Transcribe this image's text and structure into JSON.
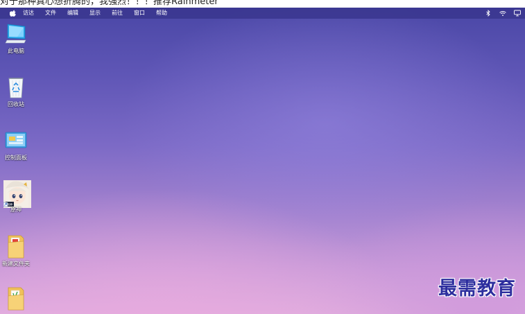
{
  "caption": "对于那种真心想折腾的，我强烈！！！推荐Rainmeter",
  "menubar": {
    "apple_icon": "apple-logo-icon",
    "items": [
      "访达",
      "文件",
      "编辑",
      "显示",
      "前往",
      "窗口",
      "帮助"
    ],
    "status_icons": [
      "bluetooth-icon",
      "wifi-icon",
      "display-icon"
    ]
  },
  "desktop": {
    "icons": [
      {
        "label": "此电脑",
        "icon": "computer-icon"
      },
      {
        "label": "回收站",
        "icon": "recycle-bin-icon"
      },
      {
        "label": "控制面板",
        "icon": "control-panel-icon"
      },
      {
        "label": "原神",
        "icon": "genshin-shortcut-icon"
      },
      {
        "label": "新建文件夹",
        "icon": "folder-icon"
      },
      {
        "label": "",
        "icon": "folder-icon"
      }
    ]
  },
  "watermark": "最需教育",
  "colors": {
    "menubar": "#3a368e",
    "wallpaper_top": "#4a47a6",
    "wallpaper_bottom": "#deadde",
    "watermark": "#2d2e9e"
  }
}
